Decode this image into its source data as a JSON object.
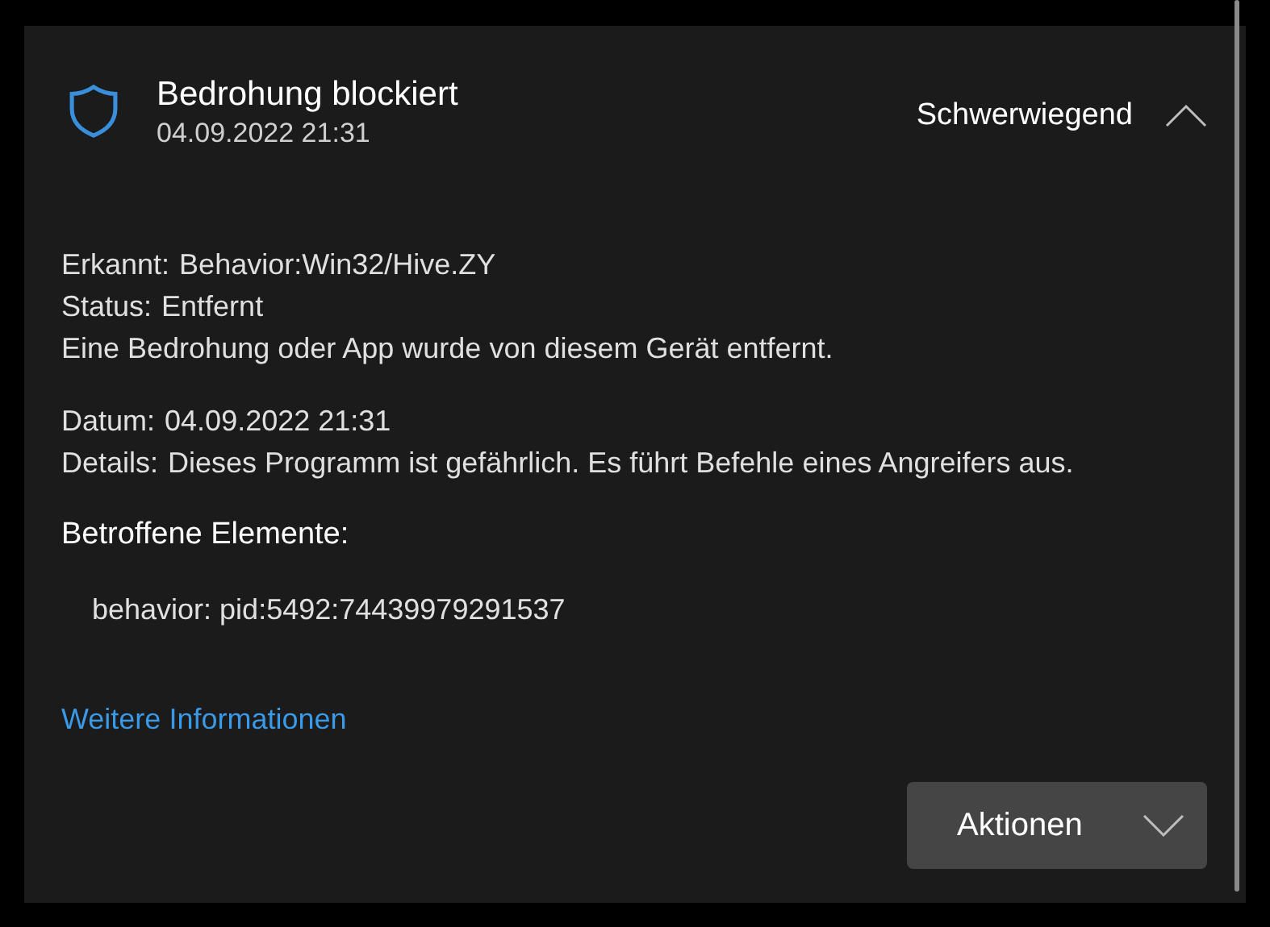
{
  "header": {
    "title": "Bedrohung blockiert",
    "date": "04.09.2022 21:31",
    "severity": "Schwerwiegend",
    "expanded": true
  },
  "fields": [
    {
      "label": "Erkannt:",
      "value": "Behavior:Win32/Hive.ZY"
    },
    {
      "label": "Status:",
      "value": "Entfernt"
    }
  ],
  "status_note": "Eine Bedrohung oder App wurde von diesem Gerät entfernt.",
  "fields2": [
    {
      "label": "Datum:",
      "value": "04.09.2022 21:31"
    },
    {
      "label": "Details:",
      "value": "Dieses Programm ist gefährlich. Es führt Befehle eines Angreifers aus."
    }
  ],
  "affected": {
    "heading": "Betroffene Elemente:",
    "items": [
      "behavior: pid:5492:74439979291537"
    ]
  },
  "link": "Weitere Informationen",
  "actions_button": "Aktionen"
}
